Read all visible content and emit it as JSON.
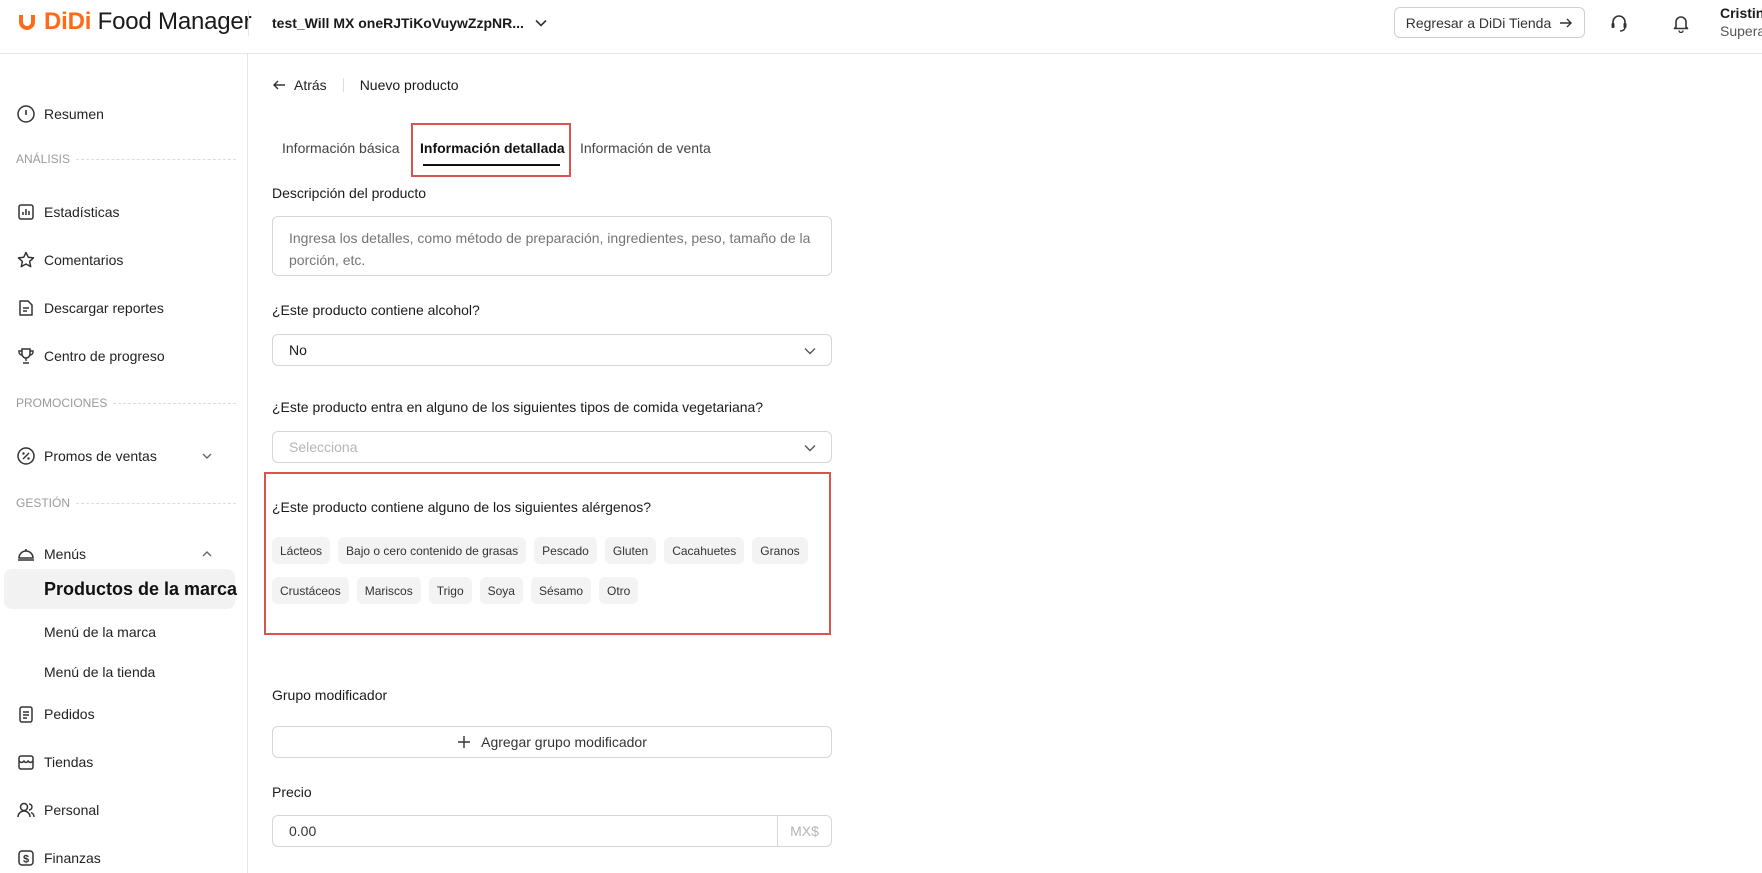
{
  "header": {
    "logo_didi": "DiDi",
    "logo_rest": " Food Manager",
    "store_name": "test_Will MX oneRJTiKoVuywZzpNR...",
    "return_label": "Regresar a DiDi Tienda",
    "user_name": "Cristina",
    "user_role": "Superadmin"
  },
  "sidebar": {
    "resumen": "Resumen",
    "section_analisis": "ANÁLISIS",
    "estadisticas": "Estadísticas",
    "comentarios": "Comentarios",
    "descargar_reportes": "Descargar reportes",
    "centro_progreso": "Centro de progreso",
    "section_promociones": "PROMOCIONES",
    "promos_ventas": "Promos de ventas",
    "section_gestion": "GESTIÓN",
    "menus": "Menús",
    "productos_marca": "Productos de la marca",
    "menu_marca": "Menú de la marca",
    "menu_tienda": "Menú de la tienda",
    "pedidos": "Pedidos",
    "tiendas": "Tiendas",
    "personal": "Personal",
    "finanzas": "Finanzas"
  },
  "breadcrumb": {
    "back_label": "Atrás",
    "title": "Nuevo producto"
  },
  "tabs": {
    "basic": "Información básica",
    "detailed": "Información detallada",
    "sale": "Información de venta"
  },
  "form": {
    "description_label": "Descripción del producto",
    "description_placeholder": "Ingresa los detalles, como método de preparación, ingredientes, peso, tamaño de la porción, etc.",
    "alcohol_label": "¿Este producto contiene alcohol?",
    "alcohol_value": "No",
    "vegetarian_label": "¿Este producto entra en alguno de los siguientes tipos de comida vegetariana?",
    "vegetarian_placeholder": "Selecciona",
    "allergens_label": "¿Este producto contiene alguno de los siguientes alérgenos?",
    "allergens_row1": [
      "Lácteos",
      "Bajo o cero contenido de grasas",
      "Pescado",
      "Gluten",
      "Cacahuetes",
      "Granos"
    ],
    "allergens_row2": [
      "Crustáceos",
      "Mariscos",
      "Trigo",
      "Soya",
      "Sésamo",
      "Otro"
    ],
    "modifier_label": "Grupo modificador",
    "modifier_button": "Agregar grupo modificador",
    "price_label": "Precio",
    "price_value": "0.00",
    "price_unit": "MX$"
  },
  "colors": {
    "brand": "#ff6a19",
    "highlight": "#d9534f"
  }
}
